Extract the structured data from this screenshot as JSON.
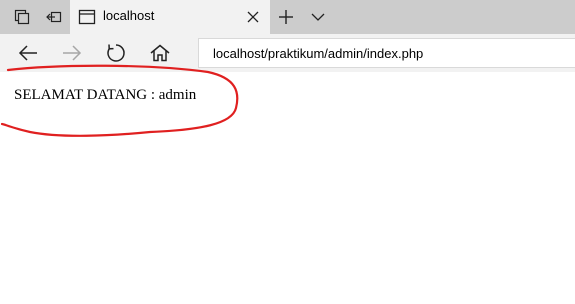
{
  "browser": {
    "tab": {
      "title": "localhost"
    },
    "address": {
      "url": "localhost/praktikum/admin/index.php"
    },
    "icons": {
      "tab_preview": "tab-preview-icon",
      "set_aside_tabs": "set-aside-tabs-icon",
      "favicon": "page-icon",
      "close": "close-icon",
      "new_tab": "plus-icon",
      "tab_list": "chevron-down-icon",
      "back": "back-arrow-icon",
      "forward": "forward-arrow-icon",
      "refresh": "refresh-icon",
      "home": "home-icon"
    }
  },
  "page": {
    "welcome_text": "SELAMAT DATANG : admin"
  },
  "colors": {
    "tabbar_bg": "#cccccc",
    "active_tab_bg": "#f2f2f2",
    "annotation_stroke": "#e02020"
  }
}
